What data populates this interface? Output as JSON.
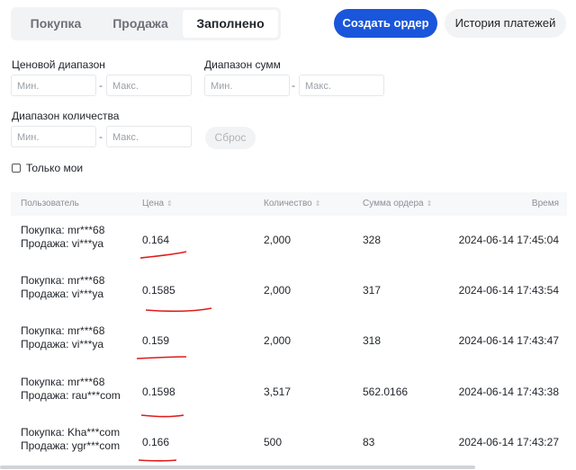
{
  "tabs": [
    "Покупка",
    "Продажа",
    "Заполнено"
  ],
  "active_tab": "Заполнено",
  "buttons": {
    "create_order": "Создать ордер",
    "payment_history": "История платежей",
    "reset": "Сброс"
  },
  "filters": {
    "price_range": {
      "label": "Ценовой диапазон",
      "min_placeholder": "Мин.",
      "max_placeholder": "Макс."
    },
    "amount_range": {
      "label": "Диапазон сумм",
      "min_placeholder": "Мин.",
      "max_placeholder": "Макс."
    },
    "quantity_range": {
      "label": "Диапазон количества",
      "min_placeholder": "Мин.",
      "max_placeholder": "Макс."
    },
    "separator": "-",
    "only_mine": {
      "label": "Только мои",
      "checked": false
    }
  },
  "table": {
    "headers": {
      "user": "Пользователь",
      "price": "Цена",
      "quantity": "Количество",
      "order_sum": "Сумма ордера",
      "time": "Время"
    },
    "sort_icon": "⇕",
    "rows": [
      {
        "buyer": "Покупка: mr***68",
        "seller": "Продажа: vi***ya",
        "price": "0.164",
        "quantity": "2,000",
        "sum": "328",
        "time": "2024-06-14 17:45:04"
      },
      {
        "buyer": "Покупка: mr***68",
        "seller": "Продажа: vi***ya",
        "price": "0.1585",
        "quantity": "2,000",
        "sum": "317",
        "time": "2024-06-14 17:43:54"
      },
      {
        "buyer": "Покупка: mr***68",
        "seller": "Продажа: vi***ya",
        "price": "0.159",
        "quantity": "2,000",
        "sum": "318",
        "time": "2024-06-14 17:43:47"
      },
      {
        "buyer": "Покупка: mr***68",
        "seller": "Продажа: rau***com",
        "price": "0.1598",
        "quantity": "3,517",
        "sum": "562.0166",
        "time": "2024-06-14 17:43:38"
      },
      {
        "buyer": "Покупка: Kha***com",
        "seller": "Продажа: ygr***com",
        "price": "0.166",
        "quantity": "500",
        "sum": "83",
        "time": "2024-06-14 17:43:27"
      }
    ]
  },
  "colors": {
    "primary": "#1a56db",
    "annotation": "#e01b1b"
  }
}
